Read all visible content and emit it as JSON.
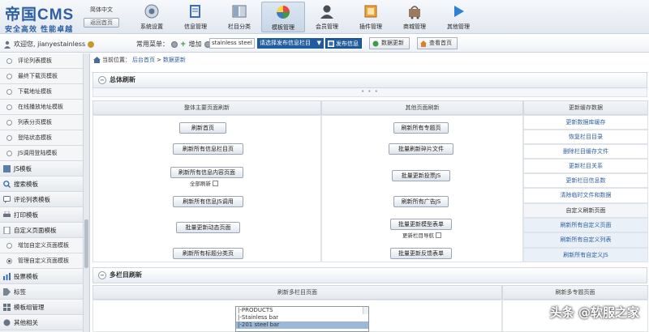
{
  "header": {
    "logo_title": "帝国CMS",
    "logo_subtitle": "安全高效 性能卓越",
    "lang_label": "简体中文",
    "back_button": "返回首页",
    "nav": [
      {
        "label": "系统设置",
        "icon": "system-settings-icon"
      },
      {
        "label": "信息管理",
        "icon": "info-manage-icon"
      },
      {
        "label": "栏目分类",
        "icon": "column-category-icon"
      },
      {
        "label": "模板管理",
        "icon": "template-manage-icon",
        "active": true
      },
      {
        "label": "会员管理",
        "icon": "member-manage-icon"
      },
      {
        "label": "插件管理",
        "icon": "plugin-manage-icon"
      },
      {
        "label": "商城管理",
        "icon": "shop-manage-icon"
      },
      {
        "label": "其他管理",
        "icon": "other-manage-icon"
      }
    ]
  },
  "subbar": {
    "welcome": "欢迎您, jianyestainless",
    "common_menu_label": "常用菜单：",
    "add_label": "增加",
    "search_value": "stainless steel sheet",
    "select_value": "请选择发布信息栏目",
    "publish_button": "发布信息",
    "update_button": "数据更新",
    "view_home_button": "查看首页"
  },
  "sidebar": {
    "items": [
      {
        "label": "评论列表模板",
        "type": "child"
      },
      {
        "label": "最终下载页模板",
        "type": "child"
      },
      {
        "label": "下载地址模板",
        "type": "child"
      },
      {
        "label": "在线播放地址模板",
        "type": "child"
      },
      {
        "label": "列表分页模板",
        "type": "child"
      },
      {
        "label": "登陆状态模板",
        "type": "child"
      },
      {
        "label": "JS调用登陆模板",
        "type": "child"
      },
      {
        "label": "JS模板",
        "type": "parent"
      },
      {
        "label": "搜索模板",
        "type": "parent"
      },
      {
        "label": "评论列表模板",
        "type": "parent"
      },
      {
        "label": "打印模板",
        "type": "parent"
      },
      {
        "label": "自定义页面模板",
        "type": "parent"
      },
      {
        "label": "增加自定义页面模板",
        "type": "child"
      },
      {
        "label": "管理自定义页面模板",
        "type": "child",
        "selected": true
      },
      {
        "label": "投票模板",
        "type": "parent"
      },
      {
        "label": "标签",
        "type": "parent"
      },
      {
        "label": "模板组管理",
        "type": "parent"
      },
      {
        "label": "其他相关",
        "type": "parent"
      }
    ]
  },
  "main": {
    "breadcrumb": [
      "当前位置：",
      "后台首页",
      "数据更新"
    ],
    "section1_title": "总体刷新",
    "col_headers": [
      "整体主要页面刷新",
      "其他页面刷新",
      "更新缓存数据"
    ],
    "left_buttons": [
      "刷新首页",
      "刷新所有信息栏目页",
      "刷新所有信息内容页面",
      "刷新所有信息JS调用",
      "批量更新动态页面",
      "刷新所有标题分类页"
    ],
    "full_refresh_label": "全部刷新",
    "mid_buttons": [
      "刷新所有专题页",
      "批量刷新碎片文件",
      "批量更新投票JS",
      "刷新所有广告JS",
      "批量更新模型表单",
      "批量更新反馈表单"
    ],
    "model_checkbox_label": "更新栏目导航",
    "right_links": [
      "更新数据库缓存",
      "恢复栏目目录",
      "删除栏目缓存文件",
      "更新栏目关系",
      "更新栏目信息数",
      "清除临时文件和数据",
      "自定义刷新页面",
      "刷新所有自定义页面",
      "刷新所有自定义列表",
      "刷新所有自定义JS"
    ],
    "section2_title": "多栏目刷新",
    "col2_headers": [
      "刷新多栏目页面",
      "刷新多专题页面"
    ],
    "list_options": [
      "|-PRODUCTS",
      "|-Stainless bar",
      "|-201 steel bar"
    ],
    "list_selected_index": 2
  },
  "watermark": "头条 @软服之家"
}
